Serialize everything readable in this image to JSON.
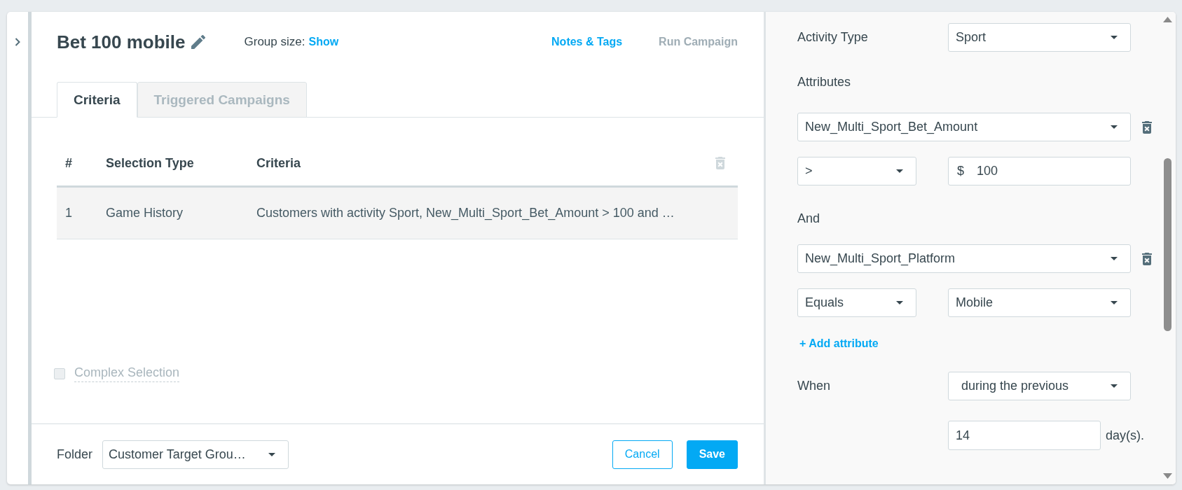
{
  "header": {
    "title": "Bet 100 mobile",
    "group_size_label": "Group size:",
    "group_size_link": "Show",
    "actions": [
      {
        "label": "Notes & Tags",
        "disabled": false
      },
      {
        "label": "Run Campaign",
        "disabled": true
      }
    ]
  },
  "tabs": [
    {
      "label": "Criteria",
      "selected": true
    },
    {
      "label": "Triggered Campaigns",
      "selected": false
    }
  ],
  "table": {
    "columns": [
      "#",
      "Selection Type",
      "Criteria"
    ],
    "delete_disabled": true,
    "rows": [
      [
        "1",
        "Game History",
        "Customers with activity Sport, New_Multi_Sport_Bet_Amount > 100 and …"
      ]
    ]
  },
  "complex_selection": {
    "label": "Complex Selection",
    "checked": false,
    "disabled": true
  },
  "footer": {
    "folder_label": "Folder",
    "folder_value": "Customer Target Grou…",
    "buttons": [
      {
        "label": "Cancel",
        "kind": "secondary"
      },
      {
        "label": "Save",
        "kind": "primary"
      }
    ]
  },
  "criteria_editor": {
    "activity": {
      "label": "Activity Type",
      "value": "Sport"
    },
    "attributes_heading": "Attributes",
    "attributes": [
      {
        "field": "New_Multi_Sport_Bet_Amount",
        "operator": ">",
        "kind": "amount",
        "currency": "$",
        "value": "100"
      },
      {
        "joiner": "And",
        "field": "New_Multi_Sport_Platform",
        "operator": "Equals",
        "kind": "select",
        "value": "Mobile"
      }
    ],
    "add_attribute": "+ Add attribute",
    "when": {
      "label": "When",
      "value": "during the previous",
      "days": "14",
      "unit": "day(s)."
    }
  }
}
